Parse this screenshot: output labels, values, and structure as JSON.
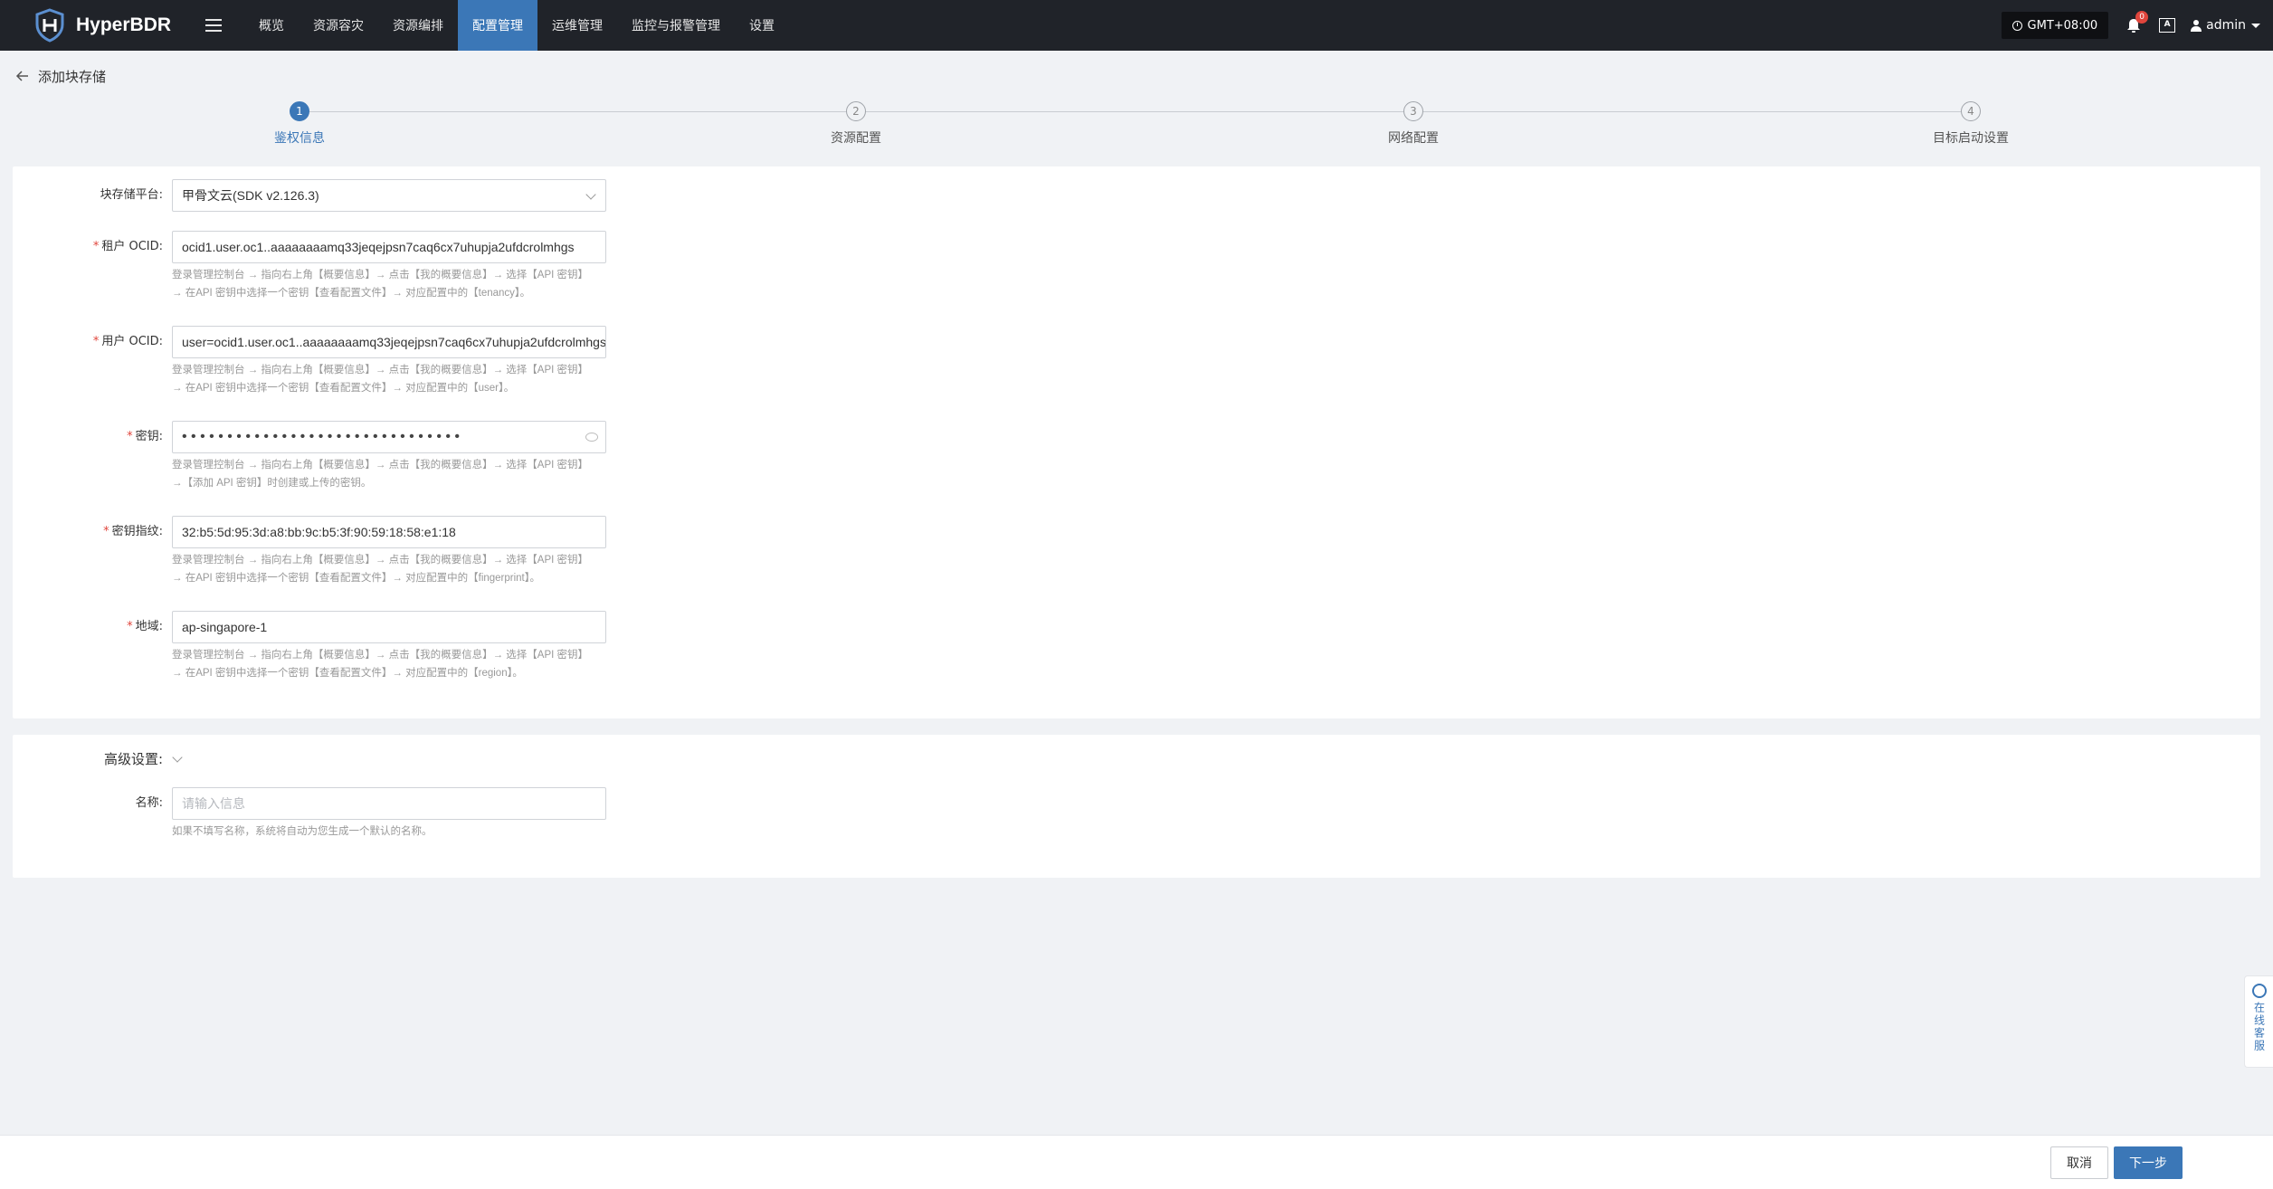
{
  "app": {
    "name": "HyperBDR"
  },
  "nav": {
    "items": [
      {
        "label": "概览",
        "active": false
      },
      {
        "label": "资源容灾",
        "active": false
      },
      {
        "label": "资源编排",
        "active": false
      },
      {
        "label": "配置管理",
        "active": true
      },
      {
        "label": "运维管理",
        "active": false
      },
      {
        "label": "监控与报警管理",
        "active": false
      },
      {
        "label": "设置",
        "active": false
      }
    ]
  },
  "header": {
    "timezone": "GMT+08:00",
    "notification_count": "0",
    "lang_label": "A",
    "user": "admin"
  },
  "page": {
    "title": "添加块存储"
  },
  "steps": [
    {
      "num": "1",
      "label": "鉴权信息",
      "active": true
    },
    {
      "num": "2",
      "label": "资源配置",
      "active": false
    },
    {
      "num": "3",
      "label": "网络配置",
      "active": false
    },
    {
      "num": "4",
      "label": "目标启动设置",
      "active": false
    }
  ],
  "form": {
    "platform": {
      "label": "块存储平台:",
      "value": "甲骨文云(SDK v2.126.3)"
    },
    "tenant_ocid": {
      "label": "租户 OCID:",
      "value": "ocid1.user.oc1..aaaaaaaamq33jeqejpsn7caq6cx7uhupja2ufdcrolmhgs",
      "hint1": "登录管理控制台 → 指向右上角【概要信息】→ 点击【我的概要信息】→ 选择【API 密钥】",
      "hint2": "→ 在API 密钥中选择一个密钥【查看配置文件】→ 对应配置中的【tenancy】。"
    },
    "user_ocid": {
      "label": "用户 OCID:",
      "value": "user=ocid1.user.oc1..aaaaaaaamq33jeqejpsn7caq6cx7uhupja2ufdcrolmhgs",
      "hint1": "登录管理控制台 → 指向右上角【概要信息】→ 点击【我的概要信息】→ 选择【API 密钥】",
      "hint2": "→ 在API 密钥中选择一个密钥【查看配置文件】→ 对应配置中的【user】。"
    },
    "secret_key": {
      "label": "密钥:",
      "value": "• • • • • • • • • • • • • • • • • • • • • • • • • • • • • • •",
      "hint1": "登录管理控制台 → 指向右上角【概要信息】→ 点击【我的概要信息】→ 选择【API 密钥】",
      "hint2": "→【添加 API 密钥】时创建或上传的密钥。"
    },
    "fingerprint": {
      "label": "密钥指纹:",
      "value": "32:b5:5d:95:3d:a8:bb:9c:b5:3f:90:59:18:58:e1:18",
      "hint1": "登录管理控制台 → 指向右上角【概要信息】→ 点击【我的概要信息】→ 选择【API 密钥】",
      "hint2": "→ 在API 密钥中选择一个密钥【查看配置文件】→ 对应配置中的【fingerprint】。"
    },
    "region": {
      "label": "地域:",
      "value": "ap-singapore-1",
      "hint1": "登录管理控制台 → 指向右上角【概要信息】→ 点击【我的概要信息】→ 选择【API 密钥】",
      "hint2": "→ 在API 密钥中选择一个密钥【查看配置文件】→ 对应配置中的【region】。"
    }
  },
  "advanced": {
    "label": "高级设置:",
    "name": {
      "label": "名称:",
      "placeholder": "请输入信息",
      "hint": "如果不填写名称，系统将自动为您生成一个默认的名称。"
    }
  },
  "footer": {
    "cancel": "取消",
    "next": "下一步"
  },
  "service": {
    "label": "在线客服"
  },
  "colors": {
    "primary": "#3b77b7",
    "topbar": "#202329",
    "required": "#e0453c"
  }
}
